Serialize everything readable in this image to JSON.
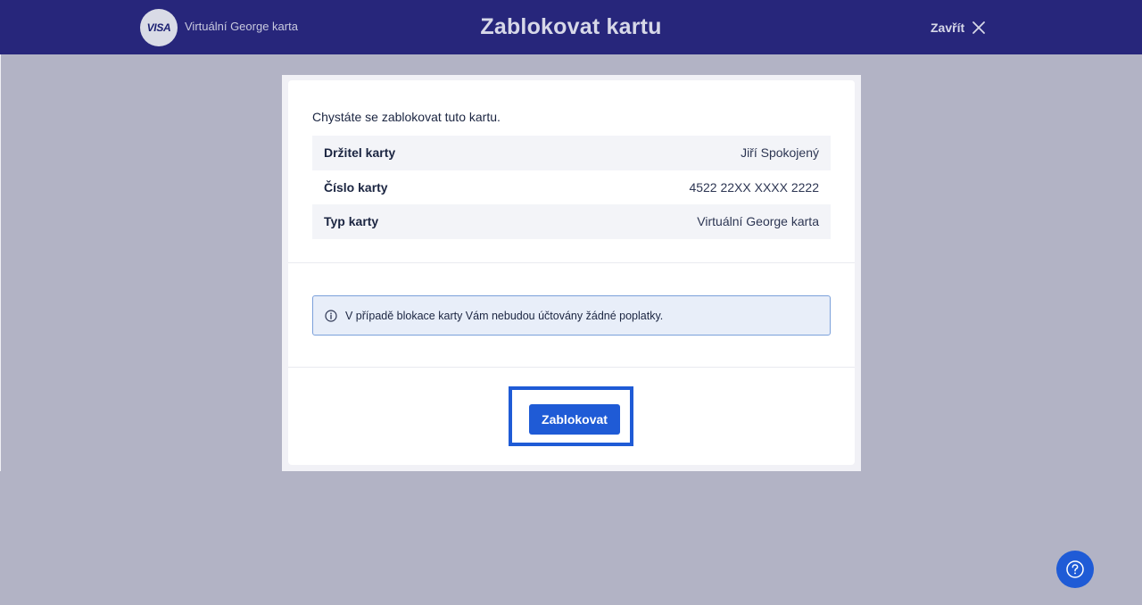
{
  "header": {
    "card_brand": "VISA",
    "card_name": "Virtuální George karta",
    "title": "Zablokovat kartu",
    "close_label": "Zavřít"
  },
  "dialog": {
    "intro": "Chystáte se zablokovat tuto kartu.",
    "rows": [
      {
        "label": "Držitel karty",
        "value": "Jiří Spokojený"
      },
      {
        "label": "Číslo karty",
        "value": "4522 22XX XXXX 2222"
      },
      {
        "label": "Typ karty",
        "value": "Virtuální George karta"
      }
    ],
    "notice": "V případě blokace karty Vám nebudou účtovány žádné poplatky.",
    "submit_label": "Zablokovat"
  },
  "icons": {
    "close": "close-icon",
    "info": "info-icon",
    "help": "help-icon"
  },
  "colors": {
    "header_bg": "#27267b",
    "backdrop": "#b2b3c5",
    "primary": "#1f5bd6",
    "notice_bg": "#e8eef9"
  }
}
